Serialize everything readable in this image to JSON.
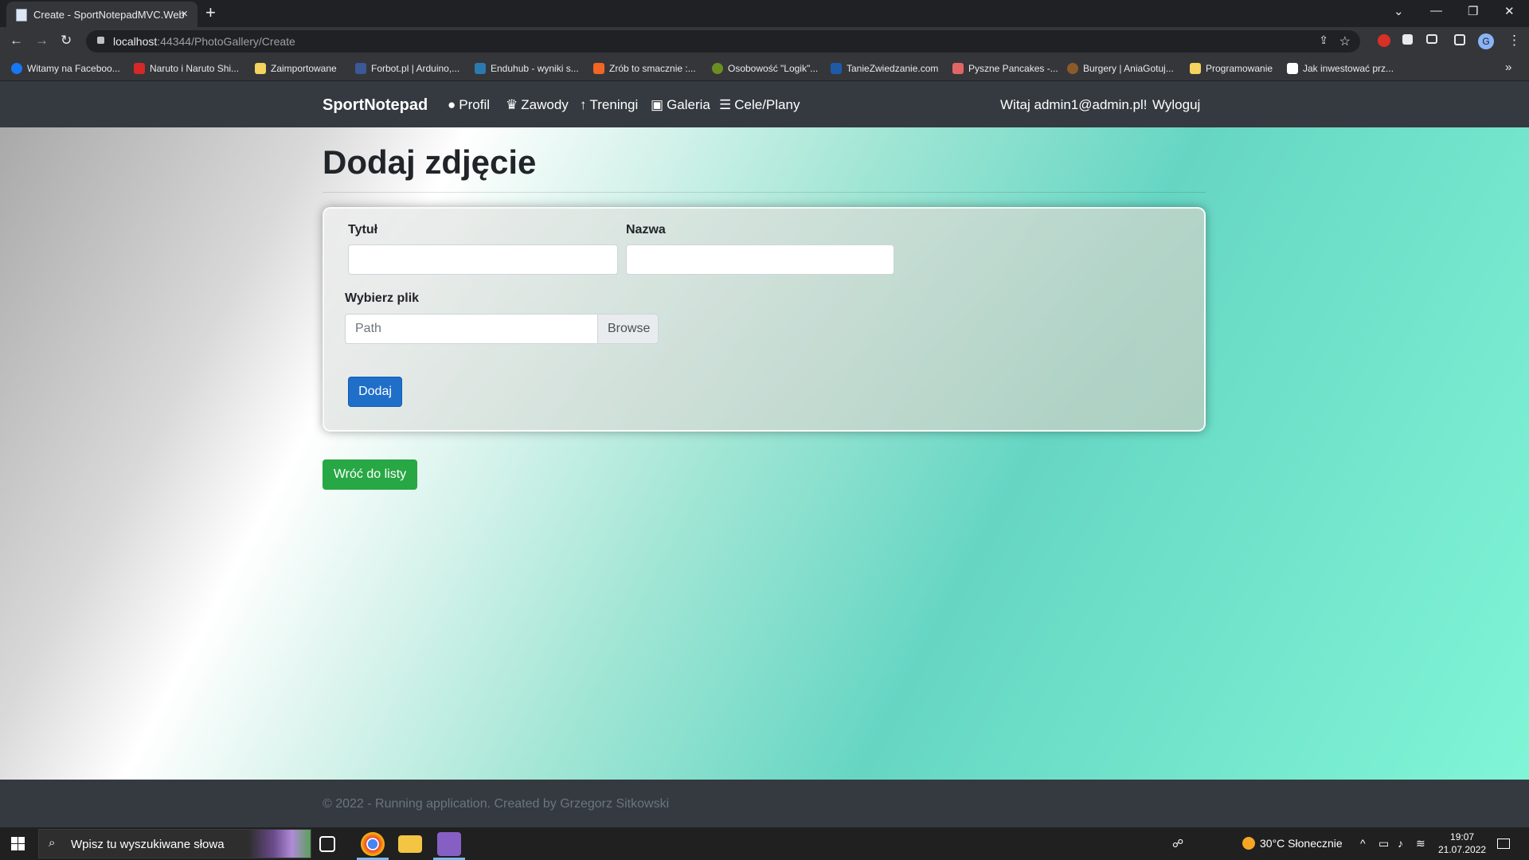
{
  "browser": {
    "tab_title": "Create - SportNotepadMVC.Web",
    "close_glyph": "×",
    "new_tab_glyph": "+",
    "window_controls": [
      "⌄",
      "—",
      "❐",
      "✕"
    ],
    "url_host": "localhost",
    "url_rest": ":44344/PhotoGallery/Create",
    "profile_initial": "G"
  },
  "bookmarks": [
    {
      "label": "Witamy na Faceboo...",
      "color": "#1877f2"
    },
    {
      "label": "Naruto i Naruto Shi...",
      "color": "#d62828"
    },
    {
      "label": "Zaimportowane",
      "color": "#f4d35e"
    },
    {
      "label": "Forbot.pl | Arduino,...",
      "color": "#3b5998"
    },
    {
      "label": "Enduhub - wyniki s...",
      "color": "#2a7ab0"
    },
    {
      "label": "Zrób to smacznie :...",
      "color": "#f26522"
    },
    {
      "label": "Osobowość \"Logik\"...",
      "color": "#6b8e23"
    },
    {
      "label": "TanieZwiedzanie.com",
      "color": "#1e5aa8"
    },
    {
      "label": "Pyszne Pancakes -...",
      "color": "#e06666"
    },
    {
      "label": "Burgery | AniaGotuj...",
      "color": "#8b5a2b"
    },
    {
      "label": "Programowanie",
      "color": "#f4d35e"
    },
    {
      "label": "Jak inwestować prz...",
      "color": "#ffffff"
    }
  ],
  "bookmarks_more": "»",
  "nav": {
    "brand": "SportNotepad",
    "items": [
      {
        "glyph": "●",
        "label": "Profil"
      },
      {
        "glyph": "♛",
        "label": "Zawody"
      },
      {
        "glyph": "↑",
        "label": "Treningi"
      },
      {
        "glyph": "▣",
        "label": "Galeria"
      },
      {
        "glyph": "☰",
        "label": "Cele/Plany"
      }
    ],
    "welcome": "Witaj admin1@admin.pl!",
    "logout": "Wyloguj"
  },
  "page": {
    "title": "Dodaj zdjęcie",
    "form": {
      "title_label": "Tytuł",
      "title_value": "",
      "name_label": "Nazwa",
      "name_value": "",
      "file_label": "Wybierz plik",
      "file_placeholder": "Path",
      "browse_label": "Browse",
      "submit_label": "Dodaj"
    },
    "back_label": "Wróć do listy"
  },
  "footer": {
    "text": "© 2022 - Running application. Created by Grzegorz Sitkowski"
  },
  "taskbar": {
    "search_placeholder": "Wpisz tu wyszukiwane słowa",
    "weather": "30°C  Słonecznie",
    "time": "19:07",
    "date": "21.07.2022"
  },
  "colors": {
    "navbar": "#343a40",
    "primary_button": "#1f6fc8",
    "success_button": "#28a745"
  }
}
